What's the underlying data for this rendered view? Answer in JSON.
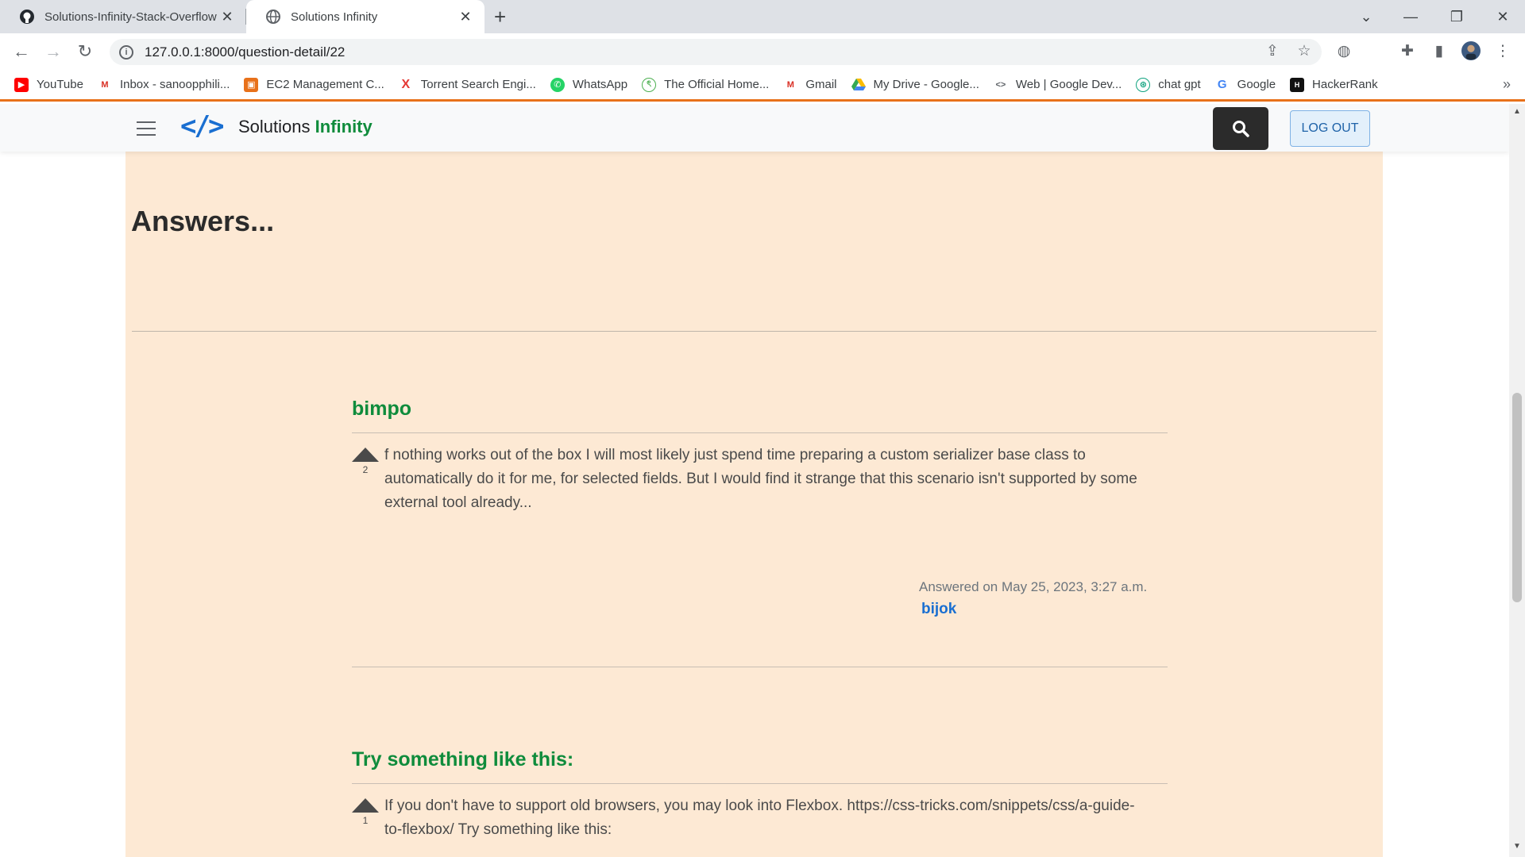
{
  "browser": {
    "tabs": [
      {
        "title": "Solutions-Infinity-Stack-Overflow",
        "icon": "github-icon",
        "active": false
      },
      {
        "title": "Solutions Infinity",
        "icon": "globe-icon",
        "active": true
      }
    ],
    "url": "127.0.0.1:8000/question-detail/22",
    "bookmarks": [
      {
        "label": "YouTube",
        "icon": "youtube-icon",
        "color": "#ff0000"
      },
      {
        "label": "Inbox - sanoopphili...",
        "icon": "gmail-icon",
        "color": "#d93025"
      },
      {
        "label": "EC2 Management C...",
        "icon": "aws-icon",
        "color": "#e8711a"
      },
      {
        "label": "Torrent Search Engi...",
        "icon": "x-icon",
        "color": "#e53935"
      },
      {
        "label": "WhatsApp",
        "icon": "whatsapp-icon",
        "color": "#25d366"
      },
      {
        "label": "The Official Home...",
        "icon": "site-icon",
        "color": "#4caf50"
      },
      {
        "label": "Gmail",
        "icon": "gmail-icon",
        "color": "#d93025"
      },
      {
        "label": "My Drive - Google...",
        "icon": "drive-icon",
        "color": "#1a73e8"
      },
      {
        "label": "Web | Google Dev...",
        "icon": "code-icon",
        "color": "#5f6368"
      },
      {
        "label": "chat gpt",
        "icon": "openai-icon",
        "color": "#10a37f"
      },
      {
        "label": "Google",
        "icon": "google-icon",
        "color": "#4285f4"
      },
      {
        "label": "HackerRank",
        "icon": "hackerrank-icon",
        "color": "#111111"
      }
    ]
  },
  "header": {
    "brand_main": "Solutions",
    "brand_accent": "Infinity",
    "logo_symbol": "</>",
    "logout_label": "LOG OUT"
  },
  "main": {
    "heading": "Answers...",
    "answers": [
      {
        "title": "bimpo",
        "votes": "2",
        "body": "f nothing works out of the box I will most likely just spend time preparing a custom serializer base class to automatically do it for me, for selected fields. But I would find it strange that this scenario isn't supported by some external tool already...",
        "answered_on": "Answered on May 25, 2023, 3:27 a.m.",
        "author": "bijok"
      },
      {
        "title": "Try something like this:",
        "votes": "1",
        "body": "If you don't have to support old browsers, you may look into Flexbox. https://css-tricks.com/snippets/css/a-guide-to-flexbox/ Try something like this:"
      }
    ]
  },
  "colors": {
    "page_bg": "#fde9d4",
    "accent_green": "#0f8c3c",
    "link_blue": "#1a6fd1",
    "bookmark_bar_border": "#e8711a"
  }
}
